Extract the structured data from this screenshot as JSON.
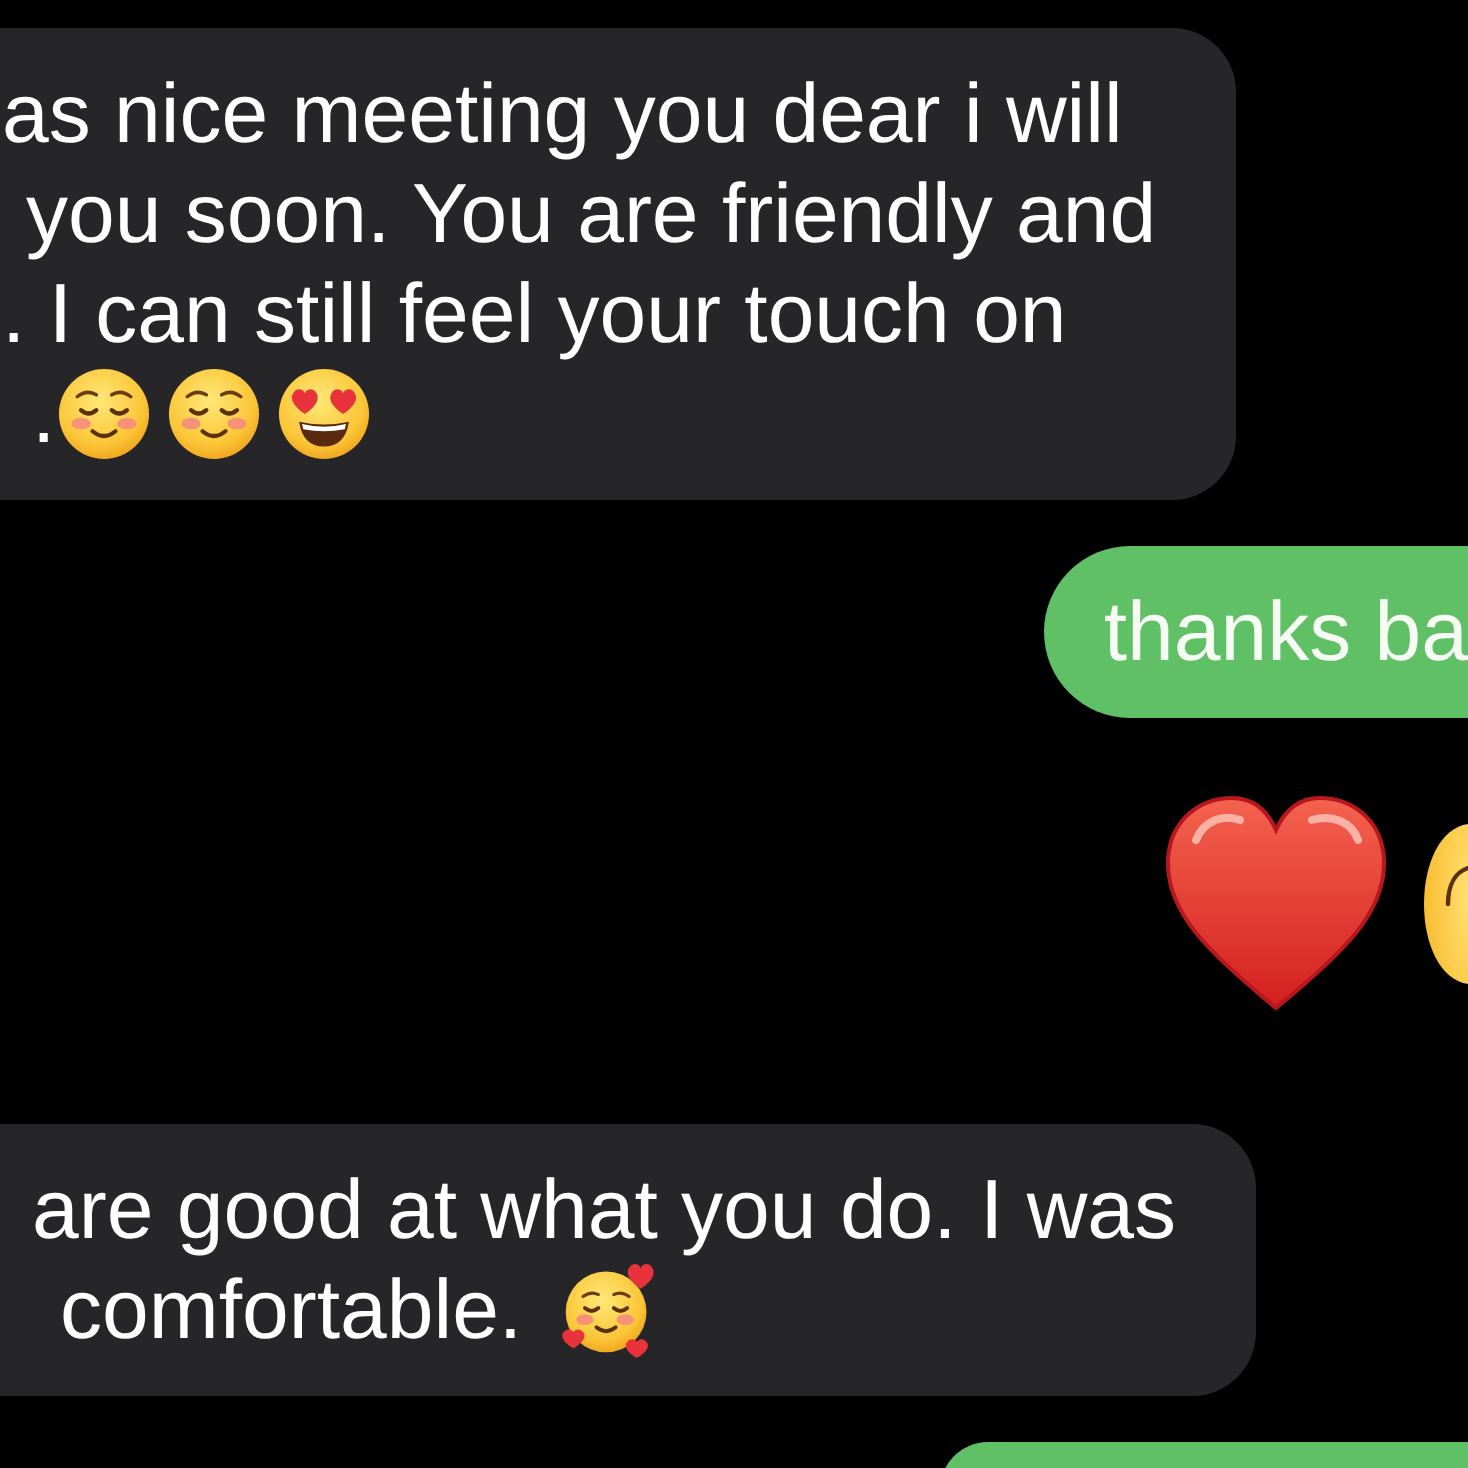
{
  "chat": [
    {
      "kind": "incoming",
      "lines": [
        "as nice meeting you dear i will",
        "you soon. You are friendly and",
        ". I can still feel your touch on",
        "."
      ],
      "emojis": [
        {
          "kind": "smiling_face"
        },
        {
          "kind": "smiling_face"
        },
        {
          "kind": "heart_eyes"
        }
      ]
    },
    {
      "kind": "outgoing",
      "lines": [
        "thanks ba"
      ]
    },
    {
      "kind": "emoji_only",
      "emojis": [
        {
          "kind": "red_heart"
        },
        {
          "kind": "face_edge"
        }
      ]
    },
    {
      "kind": "incoming",
      "lines": [
        "are good at what you do. I was",
        "comfortable."
      ],
      "emojis": [
        {
          "kind": "smiling_hearts"
        }
      ]
    },
    {
      "kind": "outgoing"
    }
  ]
}
